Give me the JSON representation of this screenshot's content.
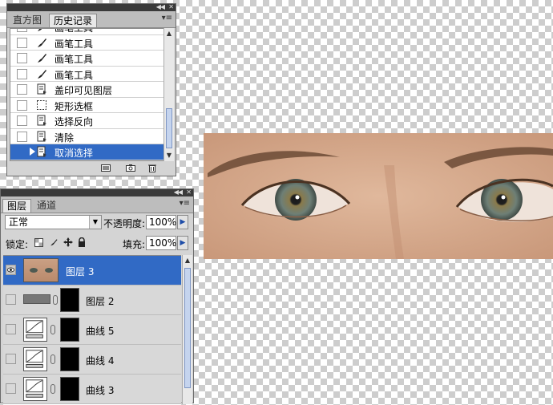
{
  "history_panel": {
    "tabs": [
      "直方图",
      "历史记录"
    ],
    "active_tab": "历史记录",
    "items": [
      {
        "label": "画笔工具",
        "icon": "brush-icon"
      },
      {
        "label": "画笔工具",
        "icon": "brush-icon"
      },
      {
        "label": "画笔工具",
        "icon": "brush-icon"
      },
      {
        "label": "画笔工具",
        "icon": "brush-icon"
      },
      {
        "label": "盖印可见图层",
        "icon": "document-icon"
      },
      {
        "label": "矩形选框",
        "icon": "marquee-icon"
      },
      {
        "label": "选择反向",
        "icon": "document-icon"
      },
      {
        "label": "清除",
        "icon": "document-icon"
      },
      {
        "label": "取消选择",
        "icon": "document-icon",
        "selected": true
      }
    ]
  },
  "layers_panel": {
    "tabs": [
      "图层",
      "通道"
    ],
    "active_tab": "图层",
    "blend_mode": "正常",
    "opacity_label": "不透明度:",
    "opacity_value": "100%",
    "lock_label": "锁定:",
    "fill_label": "填充:",
    "fill_value": "100%",
    "layers": [
      {
        "name": "图层 3",
        "selected": true,
        "visible": true,
        "type": "pixel"
      },
      {
        "name": "图层 2",
        "selected": false,
        "visible": false,
        "type": "pixel-mask"
      },
      {
        "name": "曲线 5",
        "selected": false,
        "visible": false,
        "type": "curves"
      },
      {
        "name": "曲线 4",
        "selected": false,
        "visible": false,
        "type": "curves"
      },
      {
        "name": "曲线 3",
        "selected": false,
        "visible": false,
        "type": "curves"
      }
    ]
  },
  "colors": {
    "selection": "#316ac5",
    "panel_bg": "#d4d4d4",
    "title_bar": "#3a3a3a"
  }
}
